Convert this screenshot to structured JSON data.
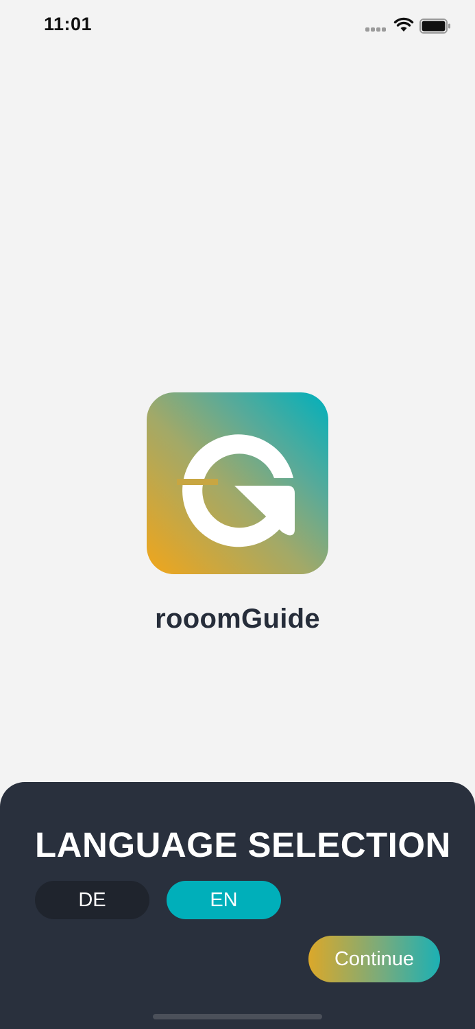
{
  "status_bar": {
    "time": "11:01",
    "icons": [
      "cellular-signal-icon",
      "wifi-icon",
      "battery-icon"
    ]
  },
  "app": {
    "logo_icon": "roomguide-g-logo-icon",
    "name": "rooomGuide"
  },
  "language_sheet": {
    "title": "LANGUAGE SELECTION",
    "options": [
      {
        "code": "DE",
        "selected": false
      },
      {
        "code": "EN",
        "selected": true
      }
    ],
    "continue_label": "Continue"
  },
  "colors": {
    "background": "#f3f3f3",
    "sheet_background": "#29303d",
    "unselected_button": "#1f242d",
    "selected_button": "#00afba",
    "brand_orange": "#f1a51a",
    "brand_teal": "#00b0bc",
    "app_name_text": "#262d3a"
  }
}
